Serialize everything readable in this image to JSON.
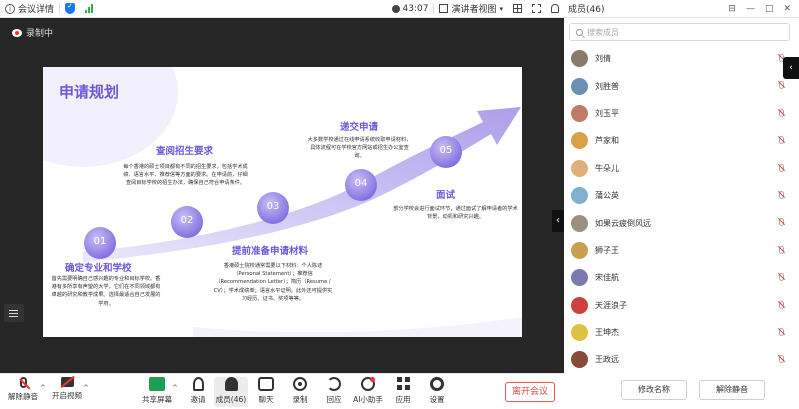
{
  "topbar": {
    "meeting_details": "会议详情",
    "time": "43:07",
    "view_mode": "演讲者视图",
    "members_tab": "成员(46)"
  },
  "stage": {
    "recording_label": "录制中"
  },
  "slide": {
    "title": "申请规划",
    "steps": [
      {
        "num": "01",
        "heading": "确定专业和学校",
        "text": "首先需要明确自己感兴趣的专业和目标学校。香港有多所享有声望的大学，它们在不同领域都有卓越的研究和教学成果。选择最适合自己发展的学府。"
      },
      {
        "num": "02",
        "heading": "查阅招生要求",
        "text": "每个香港的硕士项目都有不同的招生要求，包括学术成绩、语言水平、推荐信等方面的要求。在申请前，仔细查阅目标学校的招生办法，确保自己符合申请条件。"
      },
      {
        "num": "03",
        "heading": "提前准备申请材料",
        "text": "香港硕士院校通常需要以下材料：个人陈述（Personal Statement）；推荐信（Recommendation Letter）；简历（Resume / CV）；学术成绩单；语言水平证明。此外还可提供实习经历、证书、奖项等等。"
      },
      {
        "num": "04",
        "heading": "递交申请",
        "text": "大多数学校通过在线申请系统收取申请材料，具体流程可在学校官方网站或招生办公室查询。"
      },
      {
        "num": "05",
        "heading": "面试",
        "text": "部分学校会进行面试环节，通过面试了解申请者的学术背景、动机和研究兴趣。"
      }
    ]
  },
  "toolbar": {
    "mute": "解除静音",
    "video": "开启视频",
    "share": "共享屏幕",
    "invite": "邀请",
    "members": "成员(46)",
    "chat": "聊天",
    "record": "录制",
    "reply": "回应",
    "ai": "AI小助手",
    "apps": "应用",
    "settings": "设置",
    "leave": "离开会议"
  },
  "panel": {
    "search_placeholder": "搜索成员",
    "participants": [
      {
        "name": "刘倩",
        "color": "#8a7a6a"
      },
      {
        "name": "刘胜普",
        "color": "#6b8fb5"
      },
      {
        "name": "刘玉平",
        "color": "#c0796a"
      },
      {
        "name": "芦家和",
        "color": "#d8a24a"
      },
      {
        "name": "牛朵儿",
        "color": "#e0b078"
      },
      {
        "name": "蒲公英",
        "color": "#7fb0d0"
      },
      {
        "name": "如果云疲倒风远",
        "color": "#9a8f80"
      },
      {
        "name": "狮子王",
        "color": "#c9a050"
      },
      {
        "name": "宋佳航",
        "color": "#7a7ab0"
      },
      {
        "name": "天涯浪子",
        "color": "#d04040"
      },
      {
        "name": "王坤杰",
        "color": "#e0c040"
      },
      {
        "name": "王政远",
        "color": "#8a4a3a"
      }
    ],
    "rename_button": "修改名称",
    "unmute_button": "解除静音"
  }
}
